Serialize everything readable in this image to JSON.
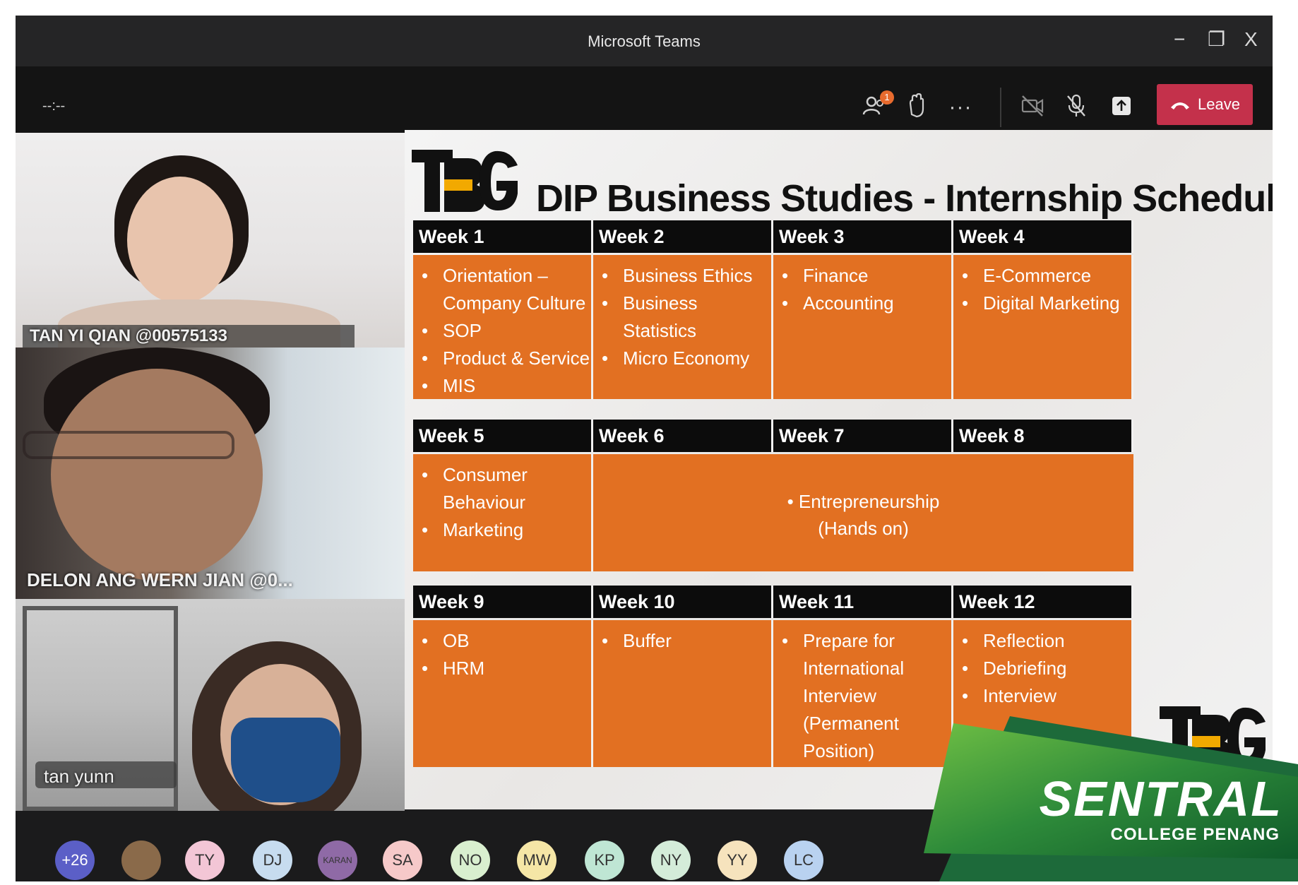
{
  "window": {
    "title": "Microsoft Teams",
    "controls": {
      "minimize": "−",
      "maximize": "❐",
      "close": "X"
    }
  },
  "toolbar": {
    "timer": "--:--",
    "participants_badge": "1",
    "leave_label": "Leave",
    "icons": [
      "participants-icon",
      "raise-hand-icon",
      "more-icon",
      "camera-off-icon",
      "mic-off-icon",
      "share-tray-icon",
      "phone-icon"
    ],
    "leave_color": "#c4314b"
  },
  "videos": [
    {
      "name": "TAN YI QIAN @00575133"
    },
    {
      "name": "DELON ANG WERN JIAN @0..."
    },
    {
      "name": "tan yunn"
    }
  ],
  "slide": {
    "logo_text": "TBG",
    "title": "DIP Business Studies - Internship Schedule",
    "accent": "#e27022",
    "rows": [
      {
        "weeks": [
          "Week 1",
          "Week 2",
          "Week 3",
          "Week 4"
        ],
        "cells": [
          [
            "Orientation – Company Culture",
            "SOP",
            "Product & Service",
            "MIS"
          ],
          [
            "Business Ethics",
            "Business Statistics",
            "Micro Economy"
          ],
          [
            "Finance",
            "Accounting"
          ],
          [
            "E-Commerce",
            "Digital Marketing"
          ]
        ]
      },
      {
        "weeks": [
          "Week 5",
          "Week 6",
          "Week 7",
          "Week 8"
        ],
        "cells": [
          [
            "Consumer Behaviour",
            "Marketing"
          ]
        ],
        "merged": [
          "• Entrepreneurship",
          "(Hands on)"
        ]
      },
      {
        "weeks": [
          "Week 9",
          "Week 10",
          "Week 11",
          "Week 12"
        ],
        "cells": [
          [
            "OB",
            "HRM"
          ],
          [
            "Buffer"
          ],
          [
            "Prepare for International Interview (Permanent Position)"
          ],
          [
            "Reflection",
            "Debriefing",
            "Interview"
          ]
        ]
      }
    ]
  },
  "participants": [
    {
      "initials": "+26",
      "color": "#5b5fc7"
    },
    {
      "initials": "",
      "color": "#8a6a4a"
    },
    {
      "initials": "TY",
      "color": "#f3c6d6"
    },
    {
      "initials": "DJ",
      "color": "#c7dcef"
    },
    {
      "initials": "KARAN",
      "color": "#8f6aa6"
    },
    {
      "initials": "SA",
      "color": "#f6c9c9"
    },
    {
      "initials": "NO",
      "color": "#d9efcf"
    },
    {
      "initials": "MW",
      "color": "#f5e6a6"
    },
    {
      "initials": "KP",
      "color": "#bfe6d4"
    },
    {
      "initials": "NY",
      "color": "#d4ecd9"
    },
    {
      "initials": "YY",
      "color": "#f6e3bd"
    },
    {
      "initials": "LC",
      "color": "#b9d2f0"
    }
  ],
  "brand": {
    "name": "SENTRAL",
    "subtitle": "COLLEGE PENANG",
    "green": "#2e8b3a"
  }
}
